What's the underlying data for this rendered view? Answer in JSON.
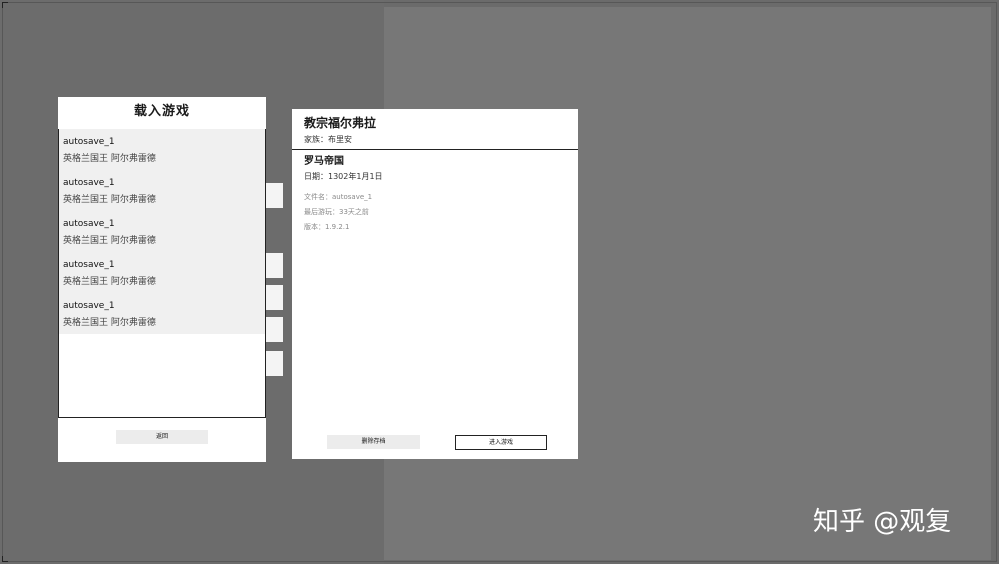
{
  "load_panel": {
    "title": "载入游戏",
    "saves": [
      {
        "name": "autosave_1",
        "subtitle": "英格兰国王 阿尔弗雷德"
      },
      {
        "name": "autosave_1",
        "subtitle": "英格兰国王 阿尔弗雷德"
      },
      {
        "name": "autosave_1",
        "subtitle": "英格兰国王 阿尔弗雷德"
      },
      {
        "name": "autosave_1",
        "subtitle": "英格兰国王 阿尔弗雷德"
      },
      {
        "name": "autosave_1",
        "subtitle": "英格兰国王 阿尔弗雷德"
      }
    ],
    "back_label": "返回"
  },
  "detail": {
    "ruler": "教宗福尔弗拉",
    "dynasty": "家族：布里安",
    "realm": "罗马帝国",
    "date": "日期：1302年1月1日",
    "filename": "文件名：autosave_1",
    "last_played": "最后游玩：33天之前",
    "version": "版本：1.9.2.1",
    "delete_label": "删除存档",
    "enter_label": "进入游戏"
  },
  "watermark": "知乎 @观复"
}
